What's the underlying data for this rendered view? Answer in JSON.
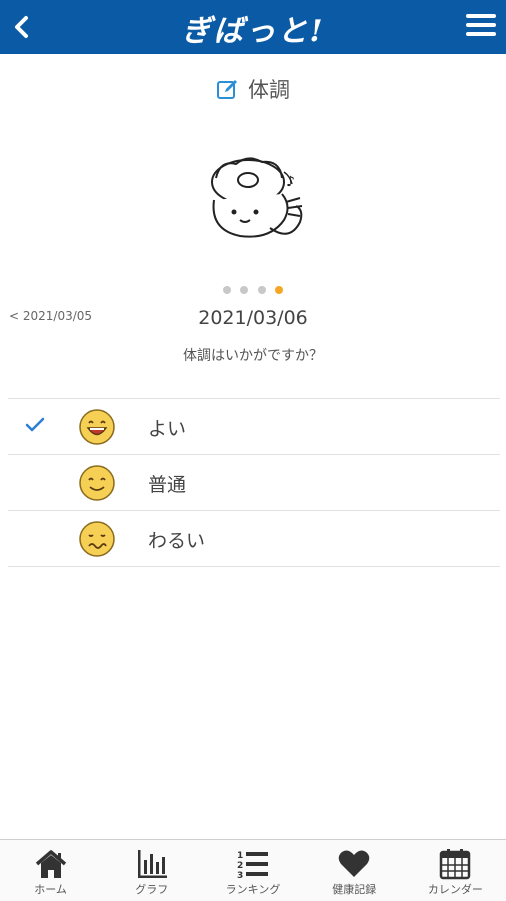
{
  "header": {
    "app_title": "ぎばっと!"
  },
  "page": {
    "title": "体調"
  },
  "pager": {
    "total": 4,
    "active_index": 4
  },
  "nav": {
    "prev_date": "< 2021/03/05",
    "current_date": "2021/03/06"
  },
  "question": "体調はいかがですか？",
  "options": [
    {
      "label": "よい",
      "face": "laughing-face-icon",
      "selected": true
    },
    {
      "label": "普通",
      "face": "smiling-face-icon",
      "selected": false
    },
    {
      "label": "わるい",
      "face": "unwell-face-icon",
      "selected": false
    }
  ],
  "tabbar": {
    "home": "ホーム",
    "graph": "グラフ",
    "ranking": "ランキング",
    "health": "健康記録",
    "calendar": "カレンダー"
  },
  "colors": {
    "header": "#0b5aa6",
    "accent": "#2b7fd1",
    "active_dot": "#f5a623",
    "face": "#f6cf55"
  }
}
